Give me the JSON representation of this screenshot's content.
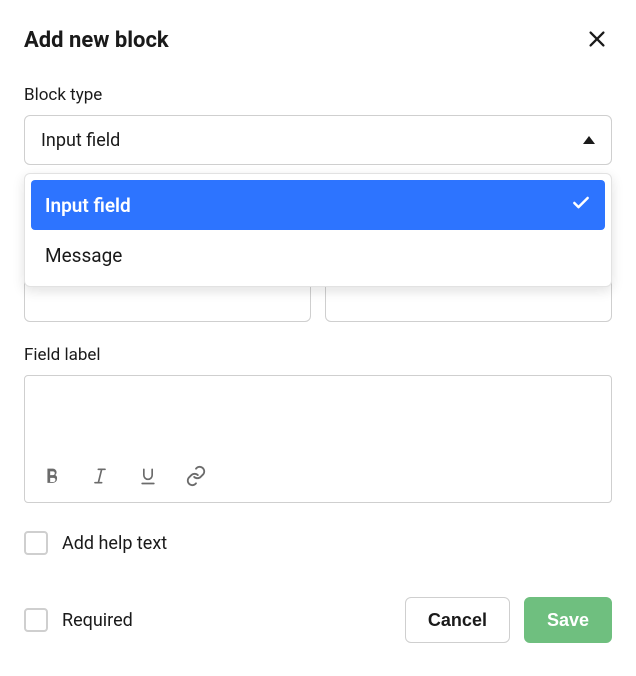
{
  "header": {
    "title": "Add new block"
  },
  "blockType": {
    "label": "Block type",
    "selected": "Input field",
    "options": [
      "Input field",
      "Message"
    ]
  },
  "fieldLabel": {
    "label": "Field label"
  },
  "checkboxes": {
    "addHelpText": "Add help text",
    "required": "Required"
  },
  "buttons": {
    "cancel": "Cancel",
    "save": "Save"
  }
}
